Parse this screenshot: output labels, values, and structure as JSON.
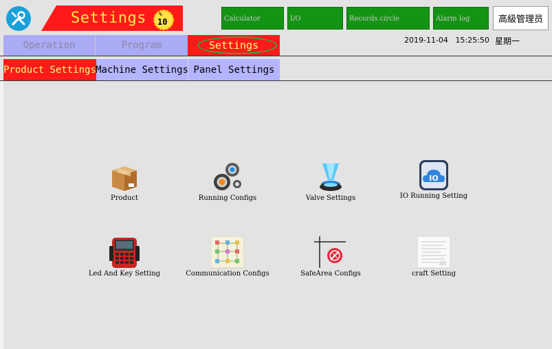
{
  "header": {
    "title": "Settings",
    "badge_top": "%",
    "badge_value": "10",
    "buttons": [
      "Calculator",
      "I/O",
      "Records circle",
      "Alarm log"
    ],
    "user": "高級管理员"
  },
  "nav": {
    "tabs": [
      "Operation",
      "Program",
      "Settings"
    ],
    "active": "Settings",
    "date": "2019-11-04",
    "time": "15:25:50",
    "weekday": "星期一"
  },
  "subnav": {
    "tabs": [
      "Product Settings",
      "Machine Settings",
      "Panel Settings"
    ],
    "active": "Product Settings"
  },
  "icons": [
    {
      "label": "Product",
      "icon": "box-icon"
    },
    {
      "label": "Running Configs",
      "icon": "gears-icon"
    },
    {
      "label": "Valve Settings",
      "icon": "hologram-icon"
    },
    {
      "label": "IO Running Setting",
      "icon": "io-cloud-icon"
    },
    {
      "label": "Led And Key Setting",
      "icon": "handheld-pendant-icon"
    },
    {
      "label": "Communication Configs",
      "icon": "network-diagram-icon"
    },
    {
      "label": "SafeArea Configs",
      "icon": "safe-area-icon"
    },
    {
      "label": "craft Setting",
      "icon": "document-icon"
    }
  ],
  "colors": {
    "active_red": "#ff1a1a",
    "tab_lavender": "#aaaaf5",
    "button_green": "#149414",
    "title_yellow": "#ffe94a"
  }
}
